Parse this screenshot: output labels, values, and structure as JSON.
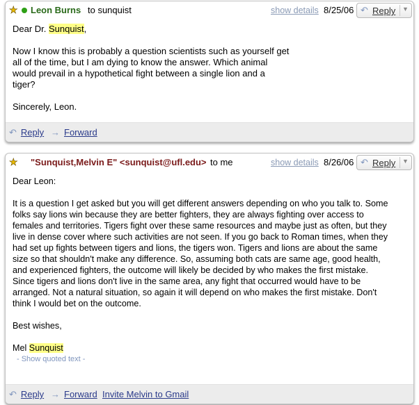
{
  "message1": {
    "sender": "Leon Burns",
    "to_text": "to sunquist",
    "show_details": "show details",
    "date": "8/25/06",
    "reply_label": "Reply",
    "greeting_prefix": "Dear Dr. ",
    "greeting_highlight": "Sunquist",
    "greeting_suffix": ",",
    "paragraph1_lines": [
      "Now I know this is probably a question scientists such as yourself get",
      "all of the time, but I am dying to know the answer.  Which animal",
      "would prevail in a hypothetical fight between a single lion and a",
      "tiger?"
    ],
    "closing": "Sincerely, Leon.",
    "footer": {
      "reply": "Reply",
      "forward": "Forward"
    }
  },
  "message2": {
    "sender": "\"Sunquist,Melvin E\" <sunquist@ufl.edu>",
    "to_text": "to me",
    "show_details": "show details",
    "date": "8/26/06",
    "reply_label": "Reply",
    "greeting": "Dear Leon:",
    "paragraph_lines": [
      "It is a question I get asked but you will get different answers depending on who you talk to.  Some",
      "folks say lions win because they are better fighters, they are always fighting over access to",
      "females and territories.  Tigers fight over these same resources and maybe just as often, but they",
      "live in dense cover where such activities are not seen.  If you go back to Roman times, when they",
      "had set up fights between tigers and lions, the tigers won.  Tigers and lions are about the same",
      "size so that shouldn't make any difference.  So, assuming both cats are same age, good health,",
      "and experienced fighters, the outcome will likely be decided by who makes the first mistake.",
      "Since tigers and lions don't live in the same area, any fight that occurred would have to be",
      "arranged.  Not a natural situation, so again it will depend on who makes the first mistake.  Don't",
      "think I would bet on the outcome."
    ],
    "closing": "Best wishes,",
    "signature_prefix": "Mel ",
    "signature_highlight": "Sunquist",
    "show_quoted": "- Show quoted text -",
    "footer": {
      "reply": "Reply",
      "forward": "Forward",
      "invite": "Invite Melvin to Gmail"
    }
  },
  "icons": {
    "star": "star-icon",
    "online": "online-status-icon",
    "reply": "reply-arrow-icon",
    "forward": "forward-arrow-icon",
    "menu": "chevron-down-icon"
  },
  "colors": {
    "sender1": "#2a6a1a",
    "sender2": "#7a1a1a",
    "link": "#2a3a8a",
    "highlight": "#ffff88",
    "star": "#e8b900",
    "online": "#2ea016"
  }
}
